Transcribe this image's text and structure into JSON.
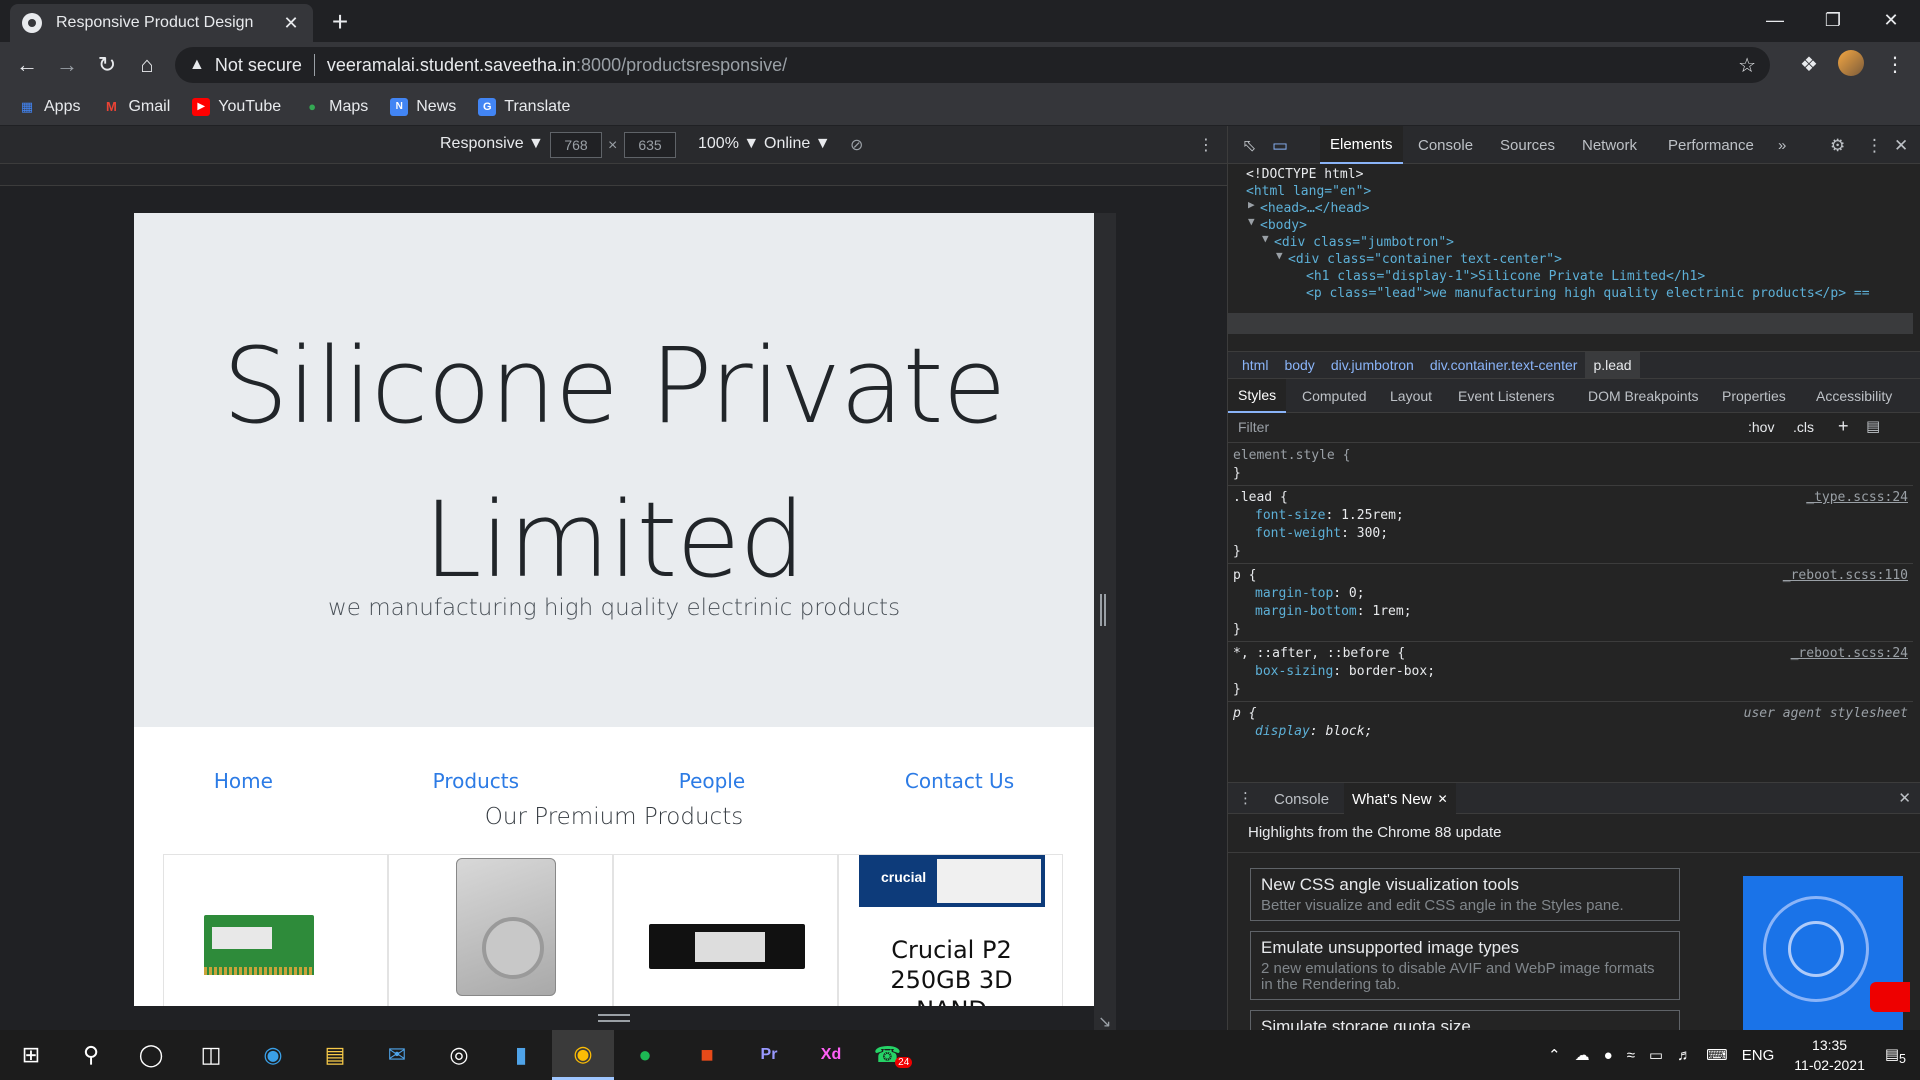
{
  "browser": {
    "tab_title": "Responsive Product Design",
    "tab_close": "✕",
    "new_tab": "+",
    "url_warning": "Not secure",
    "url_host": "veeramalai.student.saveetha.in",
    "url_path": ":8000/productsresponsive/",
    "bookmarks": [
      {
        "label": "Apps",
        "icon": "apps-grid-icon",
        "color": "#4285f4"
      },
      {
        "label": "Gmail",
        "icon": "gmail-icon",
        "color": "#ea4335"
      },
      {
        "label": "YouTube",
        "icon": "youtube-icon",
        "color": "#ff0000"
      },
      {
        "label": "Maps",
        "icon": "maps-pin-icon",
        "color": "#34a853"
      },
      {
        "label": "News",
        "icon": "news-icon",
        "color": "#4285f4"
      },
      {
        "label": "Translate",
        "icon": "translate-icon",
        "color": "#4285f4"
      }
    ]
  },
  "device_toolbar": {
    "mode": "Responsive ▼",
    "width": "768",
    "times": "×",
    "height": "635",
    "zoom": "100% ▼",
    "network": "Online ▼"
  },
  "page": {
    "title_line1": "Silicone Private",
    "title_line2": "Limited",
    "lead": "we manufacturing high quality electrinic products",
    "nav": [
      "Home",
      "Products",
      "People",
      "Contact Us"
    ],
    "section_heading": "Our Premium Products",
    "crucial_line1": "Crucial P2",
    "crucial_line2": "250GB 3D",
    "crucial_line3": "NAND"
  },
  "devtools": {
    "tabs": [
      "Elements",
      "Console",
      "Sources",
      "Network",
      "Performance",
      "»"
    ],
    "dom": [
      "<!DOCTYPE html>",
      "<html lang=\"en\">",
      "<head>…</head>",
      "<body>",
      "<div class=\"jumbotron\">",
      "<div class=\"container text-center\">",
      "<h1 class=\"display-1\">Silicone Private Limited</h1>",
      "<p class=\"lead\">we manufacturing high quality electrinic products</p> =="
    ],
    "breadcrumbs": [
      "html",
      "body",
      "div.jumbotron",
      "div.container.text-center",
      "p.lead"
    ],
    "style_tabs": [
      "Styles",
      "Computed",
      "Layout",
      "Event Listeners",
      "DOM Breakpoints",
      "Properties",
      "Accessibility"
    ],
    "filter_placeholder": "Filter",
    "hov": ":hov",
    "cls": ".cls",
    "styles": {
      "element_style": "element.style {",
      "close": "}",
      "lead_sel": ".lead {",
      "lead_src": "_type.scss:24",
      "lead_p1": "font-size",
      "lead_v1": ": 1.25rem;",
      "lead_p2": "font-weight",
      "lead_v2": ": 300;",
      "p_sel": "p {",
      "p_src": "_reboot.scss:110",
      "p_p1": "margin-top",
      "p_v1": ": 0;",
      "p_p2": "margin-bottom",
      "p_v2": ": 1rem;",
      "star_sel": "*, ::after, ::before {",
      "star_src": "_reboot.scss:24",
      "star_p1": "box-sizing",
      "star_v1": ": border-box;",
      "ua_sel": "p {",
      "ua_src": "user agent stylesheet",
      "ua_p1": "display",
      "ua_v1": ": block;"
    },
    "drawer_tabs": [
      "Console",
      "What's New"
    ],
    "whatsnew_title": "Highlights from the Chrome 88 update",
    "whatsnew_items": [
      {
        "title": "New CSS angle visualization tools",
        "desc": "Better visualize and edit CSS angle in the Styles pane."
      },
      {
        "title": "Emulate unsupported image types",
        "desc": "2 new emulations to disable AVIF and WebP image formats in the Rendering tab."
      },
      {
        "title": "Simulate storage quota size",
        "desc": ""
      }
    ]
  },
  "taskbar": {
    "language": "ENG",
    "time": "13:35",
    "date": "11-02-2021",
    "notification_count": "5",
    "whatsapp_badge": "24"
  }
}
